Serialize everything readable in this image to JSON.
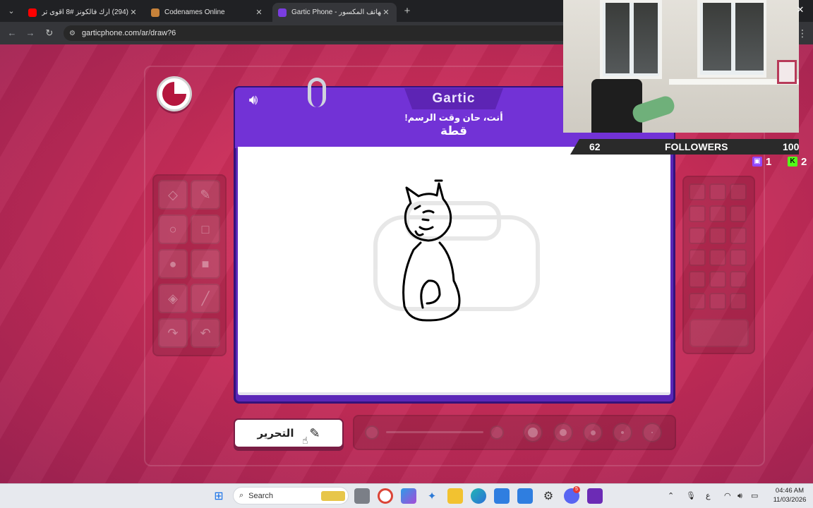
{
  "browser": {
    "tabs": [
      {
        "title": "(294) أرك فالكونز #8 اقوى ترويح",
        "favicon": "youtube-icon",
        "color": "#ff0000",
        "active": false
      },
      {
        "title": "Codenames Online",
        "favicon": "codenames-icon",
        "color": "#c7823a",
        "active": false
      },
      {
        "title": "Gartic Phone - الهاتف المكسور",
        "favicon": "gartic-icon",
        "color": "#7a3de0",
        "active": true
      }
    ],
    "new_tab_label": "+",
    "url": "garticphone.com/ar/draw?6"
  },
  "game": {
    "logo": "Gartic",
    "prompt": "أنت، حان وقت الرسم!",
    "word": "قطة",
    "edit_button": "التحرير",
    "timer_progress": 0.25,
    "accent_color": "#7232d6"
  },
  "stream": {
    "followers_count": "62",
    "followers_label": "FOLLOWERS",
    "followers_goal": "100",
    "twitch_count": "1",
    "kick_count": "2"
  },
  "taskbar": {
    "search_placeholder": "Search",
    "lang": "ع",
    "time": "04:46 AM",
    "date": "11/03/2026",
    "discord_badge": "5"
  }
}
